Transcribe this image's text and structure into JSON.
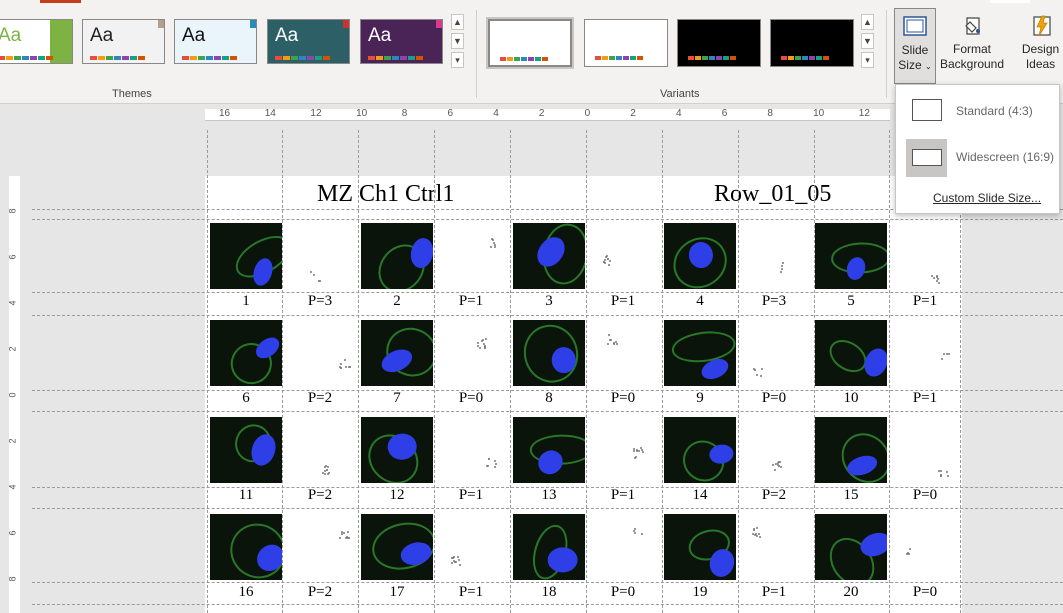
{
  "ribbon": {
    "groups": {
      "themes_label": "Themes",
      "variants_label": "Variants"
    },
    "themes": [
      {
        "sample": "Aa",
        "bg": "#ffffff",
        "accent": "#7cb342",
        "text_color": "#7cb342"
      },
      {
        "sample": "Aa",
        "bg": "#f2f2f2",
        "accent": "#b0a08a",
        "text_color": "#222222"
      },
      {
        "sample": "Aa",
        "bg": "#eaf4fb",
        "accent": "#2a8ab8",
        "text_color": "#111111"
      },
      {
        "sample": "Aa",
        "bg": "#2c5f66",
        "accent": "#c9342f",
        "text_color": "#ffffff"
      },
      {
        "sample": "Aa",
        "bg": "#4a2456",
        "accent": "#d83b8a",
        "text_color": "#ffffff"
      }
    ],
    "variants": [
      {
        "bg": "#ffffff"
      },
      {
        "bg": "#ffffff"
      },
      {
        "bg": "#000000"
      },
      {
        "bg": "#000000"
      }
    ],
    "buttons": {
      "slide_size_line1": "Slide",
      "slide_size_line2": "Size",
      "format_bg_line1": "Format",
      "format_bg_line2": "Background",
      "design_ideas_line1": "Design",
      "design_ideas_line2": "Ideas"
    }
  },
  "ruler": {
    "horizontal": [
      "16",
      "14",
      "12",
      "10",
      "8",
      "6",
      "4",
      "2",
      "0",
      "2",
      "4",
      "6",
      "8",
      "10",
      "12"
    ],
    "vertical": [
      "8",
      "6",
      "4",
      "2",
      "0",
      "2",
      "4",
      "6",
      "8"
    ]
  },
  "slide": {
    "title_left": "MZ Ch1 Ctrl1",
    "title_right": "Row_01_05",
    "cells": [
      {
        "n": "1",
        "p": "P=3"
      },
      {
        "n": "2",
        "p": "P=1"
      },
      {
        "n": "3",
        "p": "P=1"
      },
      {
        "n": "4",
        "p": "P=3"
      },
      {
        "n": "5",
        "p": "P=1"
      },
      {
        "n": "6",
        "p": "P=2"
      },
      {
        "n": "7",
        "p": "P=0"
      },
      {
        "n": "8",
        "p": "P=0"
      },
      {
        "n": "9",
        "p": "P=0"
      },
      {
        "n": "10",
        "p": "P=1"
      },
      {
        "n": "11",
        "p": "P=2"
      },
      {
        "n": "12",
        "p": "P=1"
      },
      {
        "n": "13",
        "p": "P=1"
      },
      {
        "n": "14",
        "p": "P=2"
      },
      {
        "n": "15",
        "p": "P=0"
      },
      {
        "n": "16",
        "p": "P=2"
      },
      {
        "n": "17",
        "p": "P=1"
      },
      {
        "n": "18",
        "p": "P=0"
      },
      {
        "n": "19",
        "p": "P=1"
      },
      {
        "n": "20",
        "p": "P=0"
      }
    ]
  },
  "slide_size_menu": {
    "standard": "Standard (4:3)",
    "widescreen": "Widescreen (16:9)",
    "custom": "Custom Slide Size...",
    "selected": "widescreen"
  },
  "colors": {
    "accent": "#c43e1c",
    "nucleus": "#2f3fe8",
    "cytoplasm": "#2e8a2e"
  }
}
